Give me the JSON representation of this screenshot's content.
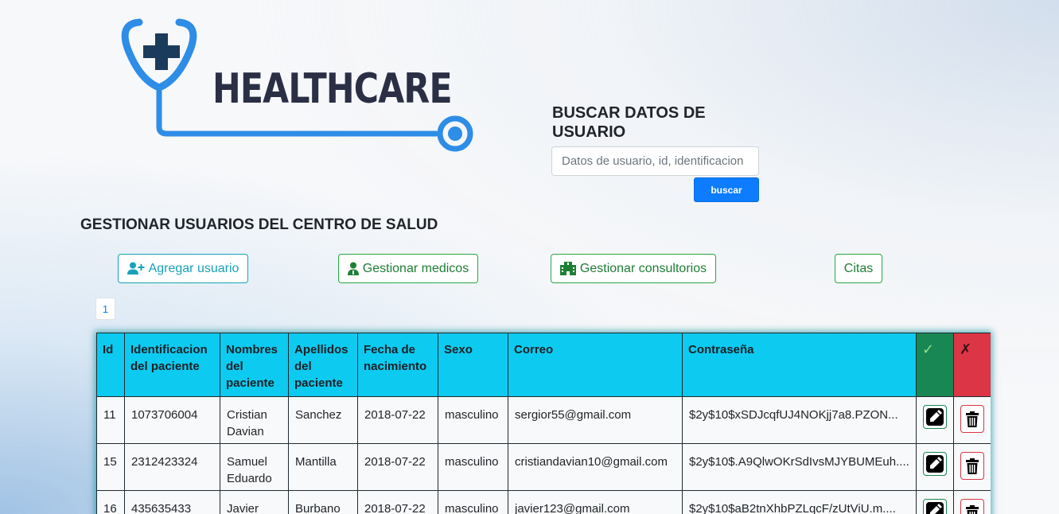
{
  "logo": {
    "text": "HEALTHCARE"
  },
  "search": {
    "title": "BUSCAR DATOS DE USUARIO",
    "placeholder": "Datos de usuario, id, identificacion",
    "button_label": "buscar"
  },
  "page_title": "GESTIONAR USUARIOS DEL CENTRO DE SALUD",
  "nav": {
    "add_user": "Agregar usuario",
    "manage_doctors": "Gestionar medicos",
    "manage_offices": "Gestionar consultorios",
    "appointments": "Citas"
  },
  "pagination": {
    "current": "1"
  },
  "colors": {
    "header": "#0dcaf0",
    "ok": "#198754",
    "danger": "#dc3545",
    "primary": "#0d7cff"
  },
  "table": {
    "headers": {
      "id": "Id",
      "identificacion": "Identificacion del paciente",
      "nombres": "Nombres del paciente",
      "apellidos": "Apellidos del paciente",
      "fecha": "Fecha de nacimiento",
      "sexo": "Sexo",
      "correo": "Correo",
      "contrasena": "Contraseña",
      "ok_icon": "✓",
      "no_icon": "✗"
    },
    "rows": [
      {
        "id": "11",
        "identificacion": "1073706004",
        "nombres": "Cristian Davian",
        "apellidos": "Sanchez",
        "fecha": "2018-07-22",
        "sexo": "masculino",
        "correo": "sergior55@gmail.com",
        "contrasena": "$2y$10$xSDJcqfUJ4NOKjj7a8.PZON..."
      },
      {
        "id": "15",
        "identificacion": "2312423324",
        "nombres": "Samuel Eduardo",
        "apellidos": "Mantilla",
        "fecha": "2018-07-22",
        "sexo": "masculino",
        "correo": "cristiandavian10@gmail.com",
        "contrasena": "$2y$10$.A9QlwOKrSdIvsMJYBUMEuh...."
      },
      {
        "id": "16",
        "identificacion": "435635433",
        "nombres": "Javier",
        "apellidos": "Burbano",
        "fecha": "2018-07-22",
        "sexo": "masculino",
        "correo": "javier123@gmail.com",
        "contrasena": "$2y$10$aB2tnXhbPZLqcF/zUtViU.m...."
      }
    ]
  }
}
